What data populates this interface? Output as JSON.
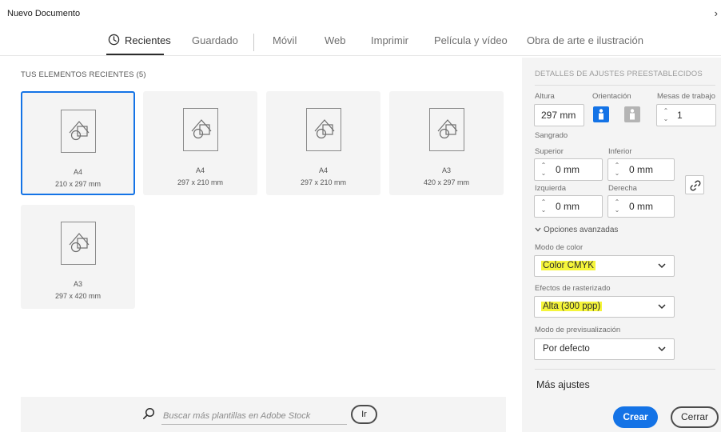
{
  "window": {
    "title": "Nuevo Documento",
    "expand_glyph": "›"
  },
  "tabs": [
    {
      "label": "Recientes",
      "active": true,
      "icon": "clock-icon"
    },
    {
      "label": "Guardado"
    },
    {
      "label": "Móvil"
    },
    {
      "label": "Web"
    },
    {
      "label": "Imprimir"
    },
    {
      "label": "Película y vídeo"
    },
    {
      "label": "Obra de arte e ilustración"
    }
  ],
  "recent": {
    "title": "TUS ELEMENTOS RECIENTES  (5)",
    "items": [
      {
        "name": "A4",
        "size": "210 x 297 mm",
        "selected": true
      },
      {
        "name": "A4",
        "size": "297 x 210 mm"
      },
      {
        "name": "A4",
        "size": "297 x 210 mm"
      },
      {
        "name": "A3",
        "size": "420 x 297 mm"
      },
      {
        "name": "A3",
        "size": "297 x 420 mm"
      }
    ]
  },
  "search": {
    "placeholder": "Buscar más plantillas en Adobe Stock",
    "go_label": "Ir"
  },
  "details": {
    "heading": "DETALLES DE AJUSTES PREESTABLECIDOS",
    "altura_label": "Altura",
    "altura_value": "297 mm",
    "orientacion_label": "Orientación",
    "mesas_label": "Mesas de trabajo",
    "mesas_value": "1",
    "sangrado_label": "Sangrado",
    "superior_label": "Superior",
    "superior_value": "0 mm",
    "inferior_label": "Inferior",
    "inferior_value": "0 mm",
    "izquierda_label": "Izquierda",
    "izquierda_value": "0 mm",
    "derecha_label": "Derecha",
    "derecha_value": "0 mm",
    "advanced_label": "Opciones avanzadas",
    "color_mode_label": "Modo de color",
    "color_mode_value": "Color CMYK",
    "raster_label": "Efectos de rasterizado",
    "raster_value": "Alta (300 ppp)",
    "preview_label": "Modo de previsualización",
    "preview_value": "Por defecto",
    "more_settings": "Más ajustes",
    "create_label": "Crear",
    "close_label": "Cerrar"
  },
  "colors": {
    "accent": "#1473e6",
    "highlight": "#f5f53a",
    "panel": "#f4f4f4"
  }
}
